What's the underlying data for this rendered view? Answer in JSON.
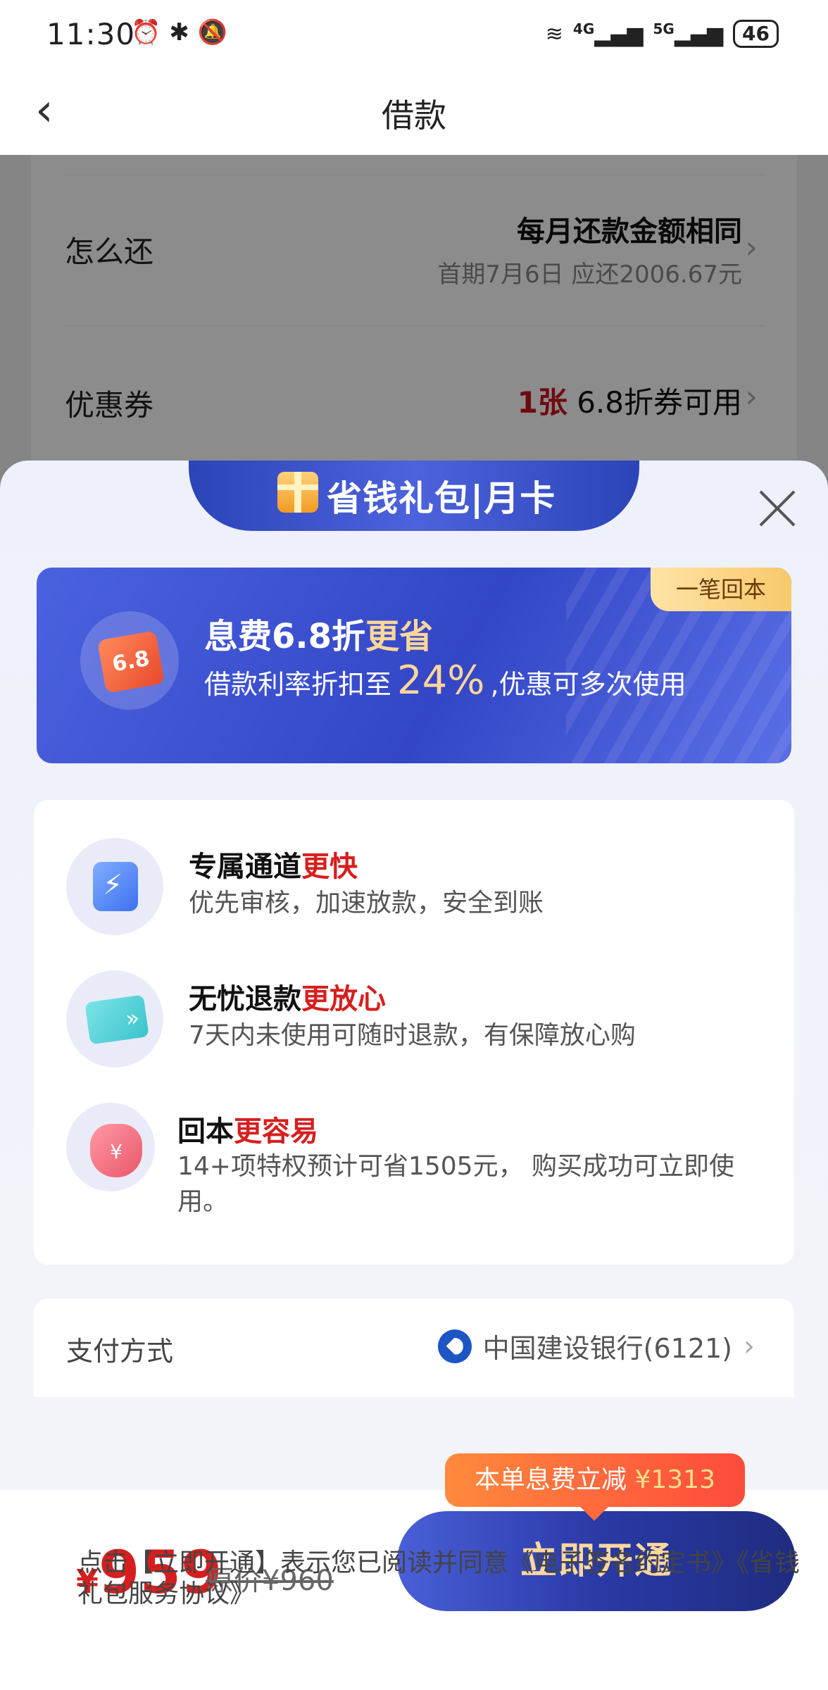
{
  "status_bar": {
    "time": "11:30",
    "left_icons": [
      "alarm-icon",
      "bluetooth-icon",
      "mute-icon"
    ],
    "signal_1": "4G",
    "signal_2": "5G",
    "battery": "46"
  },
  "header": {
    "back_glyph": "‹",
    "title": "借款"
  },
  "background_form": {
    "repay": {
      "label": "怎么还",
      "value": "每月还款金额相同",
      "sub": "首期7月6日 应还2006.67元"
    },
    "coupon": {
      "label": "优惠券",
      "count": "1张",
      "value": "6.8折券可用"
    }
  },
  "sheet": {
    "title": "省钱礼包|月卡",
    "promo": {
      "badge": "一笔回本",
      "icon_text": "6.8",
      "title": "息费6.8折",
      "title_highlight": "更省",
      "sub_prefix": "借款利率折扣至",
      "sub_rate": "24%",
      "sub_suffix": ",优惠可多次使用"
    },
    "benefits": [
      {
        "title": "专属通道",
        "highlight": "更快",
        "desc": "优先审核，加速放款，安全到账",
        "icon": "lightning-icon"
      },
      {
        "title": "无忧退款",
        "highlight": "更放心",
        "desc": "7天内未使用可随时退款，有保障放心购",
        "icon": "card-icon"
      },
      {
        "title": "回本",
        "highlight": "更容易",
        "desc": "14+项特权预计可省1505元， 购买成功可立即使用。",
        "icon": "money-bag-icon"
      }
    ],
    "payment": {
      "label": "支付方式",
      "bank": "中国建设银行(6121)"
    }
  },
  "bottom": {
    "save_tip_prefix": "本单息费立减",
    "save_tip_amount": "¥1313",
    "currency": "¥",
    "price": "959",
    "original_price": "原价¥960",
    "button": "立即开通",
    "agreement": "点击【立即开通】表示您已阅读并同意《电子签名约定书》《省钱礼包服务协议》"
  }
}
